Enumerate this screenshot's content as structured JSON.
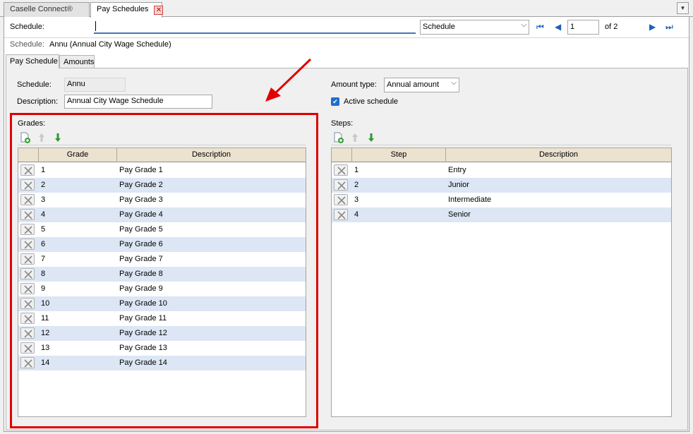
{
  "tabs": [
    {
      "label": "Caselle Connect®"
    },
    {
      "label": "Pay Schedules"
    }
  ],
  "search": {
    "label": "Schedule:",
    "value": "",
    "type_select": "Schedule",
    "record": "1",
    "of_label": "of 2"
  },
  "record_title": {
    "label": "Schedule:",
    "value": "Annu (Annual City Wage Schedule)"
  },
  "inner_tabs": [
    {
      "label": "Pay Schedule"
    },
    {
      "label": "Amounts"
    }
  ],
  "form": {
    "schedule_label": "Schedule:",
    "schedule_value": "Annu",
    "description_label": "Description:",
    "description_value": "Annual City Wage Schedule",
    "amount_type_label": "Amount type:",
    "amount_type_value": "Annual amount",
    "active_label": "Active schedule",
    "active_checked": true
  },
  "grades": {
    "title": "Grades:",
    "columns": [
      "Grade",
      "Description"
    ],
    "rows": [
      {
        "grade": "1",
        "description": "Pay Grade 1"
      },
      {
        "grade": "2",
        "description": "Pay Grade 2"
      },
      {
        "grade": "3",
        "description": "Pay Grade 3"
      },
      {
        "grade": "4",
        "description": "Pay Grade 4"
      },
      {
        "grade": "5",
        "description": "Pay Grade 5"
      },
      {
        "grade": "6",
        "description": "Pay Grade 6"
      },
      {
        "grade": "7",
        "description": "Pay Grade 7"
      },
      {
        "grade": "8",
        "description": "Pay Grade 8"
      },
      {
        "grade": "9",
        "description": "Pay Grade 9"
      },
      {
        "grade": "10",
        "description": "Pay Grade 10"
      },
      {
        "grade": "11",
        "description": "Pay Grade 11"
      },
      {
        "grade": "12",
        "description": "Pay Grade 12"
      },
      {
        "grade": "13",
        "description": "Pay Grade 13"
      },
      {
        "grade": "14",
        "description": "Pay Grade 14"
      }
    ]
  },
  "steps": {
    "title": "Steps:",
    "columns": [
      "Step",
      "Description"
    ],
    "rows": [
      {
        "step": "1",
        "description": "Entry"
      },
      {
        "step": "2",
        "description": "Junior"
      },
      {
        "step": "3",
        "description": "Intermediate"
      },
      {
        "step": "4",
        "description": "Senior"
      }
    ]
  },
  "colors": {
    "highlight": "#e00000",
    "row_alt": "#dce6f4",
    "header_bg": "#ebe2cf",
    "accent_blue": "#1e5fbf"
  },
  "icons": {
    "add": "add-row-icon",
    "up": "move-up-icon",
    "down": "move-down-icon",
    "delete": "delete-row-icon",
    "arrow": "red-arrow-annotation"
  }
}
